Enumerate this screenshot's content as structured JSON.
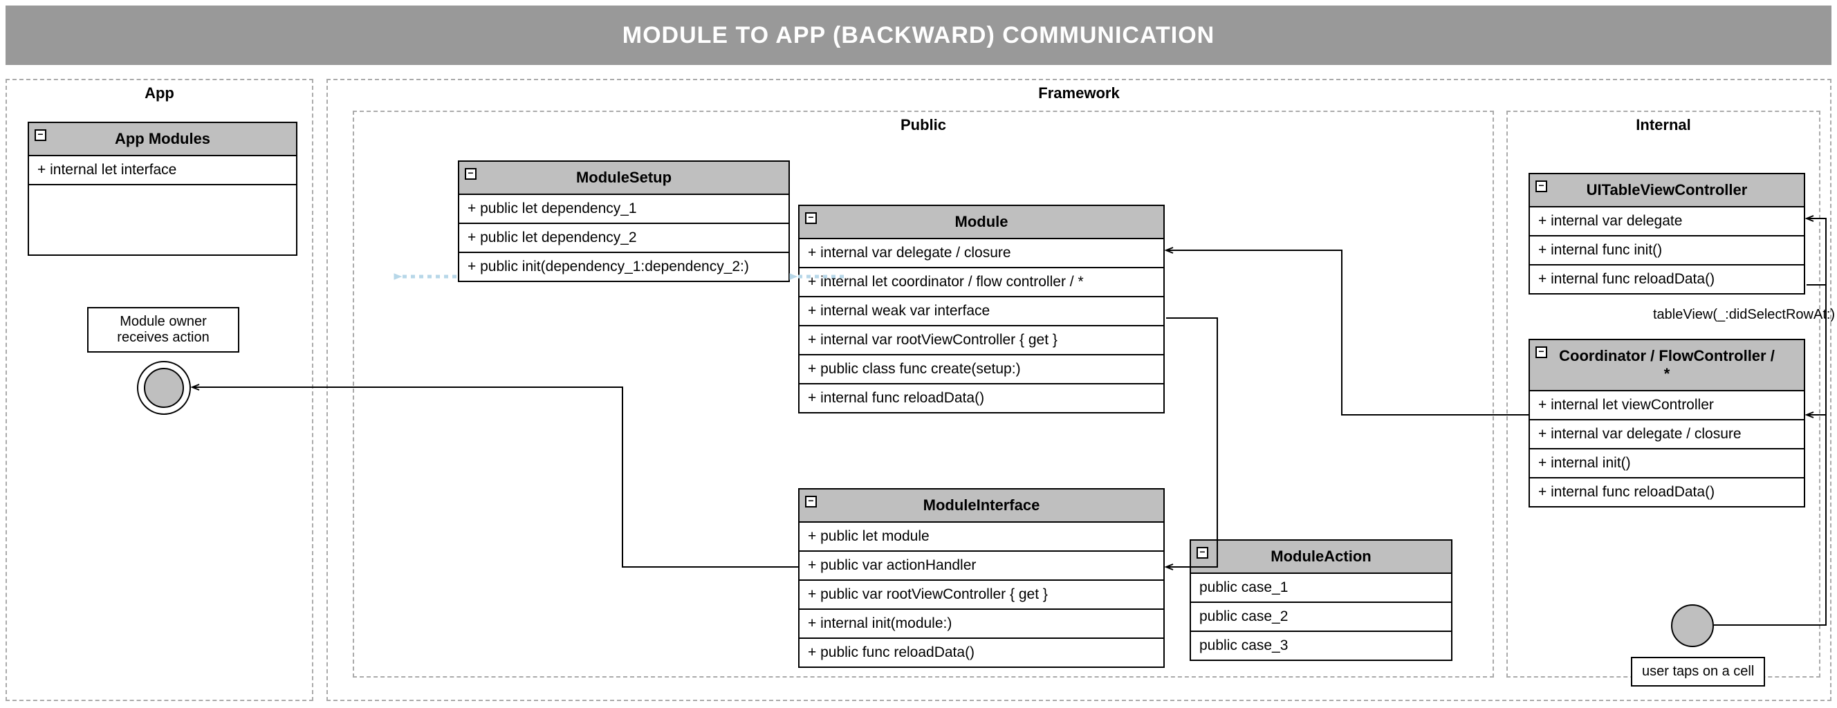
{
  "title": "MODULE TO APP (BACKWARD) COMMUNICATION",
  "regions": {
    "app": {
      "label": "App"
    },
    "framework": {
      "label": "Framework"
    },
    "public": {
      "label": "Public"
    },
    "internal": {
      "label": "Internal"
    }
  },
  "classes": {
    "app_modules": {
      "name": "App Modules",
      "rows": [
        "+ internal let interface"
      ]
    },
    "module_setup": {
      "name": "ModuleSetup",
      "rows": [
        "+ public let dependency_1",
        "+ public let dependency_2",
        "+ public init(dependency_1:dependency_2:)"
      ]
    },
    "module": {
      "name": "Module",
      "rows": [
        "+ internal var delegate / closure",
        "+ internal let coordinator / flow controller / *",
        "+ internal weak var interface",
        "+ internal var rootViewController { get }",
        "+ public class func create(setup:)",
        "+ internal func reloadData()"
      ]
    },
    "module_interface": {
      "name": "ModuleInterface",
      "rows": [
        "+ public let module",
        "+ public var actionHandler",
        "+ public var rootViewController { get }",
        "+ internal init(module:)",
        "+ public func reloadData()"
      ]
    },
    "module_action": {
      "name": "ModuleAction",
      "rows": [
        "public case_1",
        "public case_2",
        "public case_3"
      ]
    },
    "ui_table": {
      "name": "UITableViewController",
      "rows": [
        "+ internal var delegate",
        "+ internal func init()",
        "+ internal func reloadData()"
      ]
    },
    "coordinator": {
      "name": "Coordinator / FlowController / *",
      "rows": [
        "+ internal let viewController",
        "+ internal var delegate / closure",
        "+ internal init()",
        "+ internal func reloadData()"
      ]
    }
  },
  "notes": {
    "owner": {
      "line1": "Module owner",
      "line2": "receives action"
    },
    "usertap": {
      "text": "user taps on a cell"
    }
  },
  "labels": {
    "delegate_call": "tableView(_:didSelectRowAt:)"
  }
}
